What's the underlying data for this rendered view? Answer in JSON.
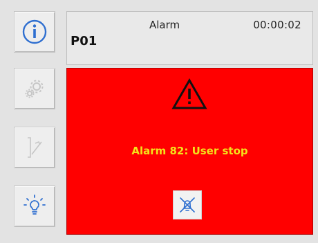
{
  "header": {
    "state": "Alarm",
    "timer": "00:00:02",
    "id": "P01"
  },
  "sidebar": {
    "buttons": [
      {
        "icon": "info-icon",
        "enabled": true
      },
      {
        "icon": "gear-icon",
        "enabled": false
      },
      {
        "icon": "curve-icon",
        "enabled": false
      },
      {
        "icon": "lightbulb-icon",
        "enabled": true
      }
    ]
  },
  "alarm": {
    "message": "Alarm 82: User stop",
    "icon": "warning-triangle-icon",
    "mute_icon": "alarm-mute-icon"
  },
  "colors": {
    "alarm_bg": "#ff0000",
    "alarm_text": "#f4e21a",
    "accent_blue": "#2f6fd0"
  }
}
